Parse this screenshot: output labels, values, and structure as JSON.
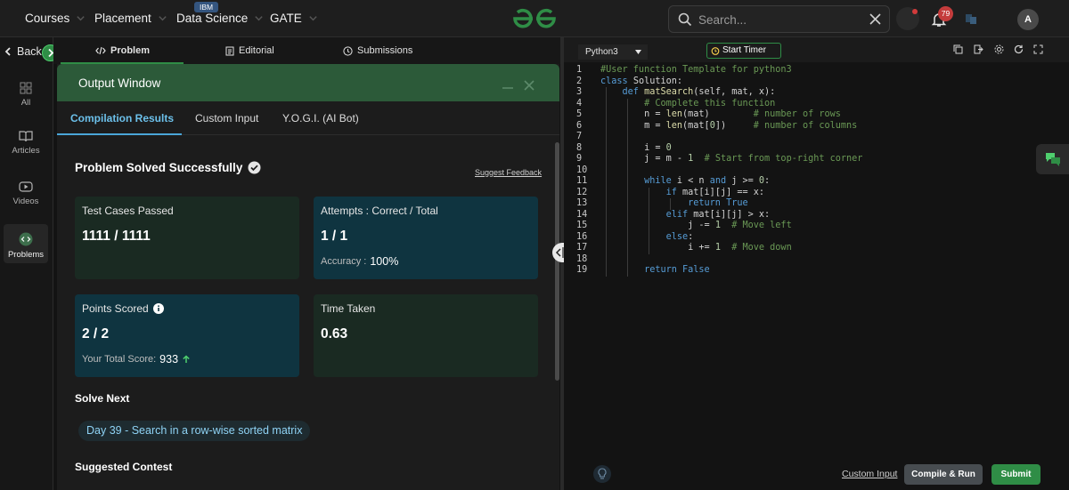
{
  "topnav": {
    "items": [
      {
        "label": "Courses"
      },
      {
        "label": "Placement"
      },
      {
        "label": "Data Science",
        "badge": "IBM"
      },
      {
        "label": "GATE"
      }
    ],
    "logo_icon": "geeksforgeeks-logo-icon",
    "search_placeholder": "Search...",
    "notification_count": "79",
    "avatar_initial": "A"
  },
  "sidebar": {
    "back_label": "Back",
    "items": [
      {
        "label": "All",
        "icon": "grid-icon"
      },
      {
        "label": "Articles",
        "icon": "book-icon"
      },
      {
        "label": "Videos",
        "icon": "video-icon"
      },
      {
        "label": "Problems",
        "icon": "code-icon",
        "active": true
      }
    ]
  },
  "problem_tabs": [
    {
      "label": "Problem",
      "active": true
    },
    {
      "label": "Editorial"
    },
    {
      "label": "Submissions"
    }
  ],
  "output": {
    "title": "Output Window",
    "tabs": [
      {
        "label": "Compilation Results",
        "active": true
      },
      {
        "label": "Custom Input"
      },
      {
        "label": "Y.O.G.I. (AI Bot)"
      }
    ],
    "status": "Problem Solved Successfully",
    "feedback_link": "Suggest Feedback",
    "cards": {
      "tests": {
        "label": "Test Cases Passed",
        "value": "1111 / 1111"
      },
      "attempts": {
        "label": "Attempts : Correct / Total",
        "value": "1 / 1",
        "sub_label": "Accuracy :",
        "sub_value": "100%"
      },
      "points": {
        "label": "Points Scored",
        "value": "2 / 2",
        "sub_label": "Your Total Score:",
        "sub_value": "933"
      },
      "time": {
        "label": "Time Taken",
        "value": "0.63"
      }
    },
    "solve_next_title": "Solve Next",
    "solve_next_item": "Day 39 - Search in a row-wise sorted matrix",
    "suggested_contest_title": "Suggested Contest"
  },
  "editor": {
    "language": "Python3",
    "timer_label": "Start Timer",
    "line_numbers": [
      "1",
      "2",
      "3",
      "4",
      "5",
      "6",
      "7",
      "8",
      "9",
      "10",
      "11",
      "12",
      "13",
      "14",
      "15",
      "16",
      "17",
      "18",
      "19"
    ],
    "code_lines": [
      [
        {
          "t": "#User function Template for python3",
          "c": "cm"
        }
      ],
      [
        {
          "t": "class ",
          "c": "kw"
        },
        {
          "t": "Solution:",
          "c": "pl"
        }
      ],
      [
        {
          "t": "    def ",
          "c": "kw"
        },
        {
          "t": "matSearch",
          "c": "df"
        },
        {
          "t": "(self, mat, x):",
          "c": "pl"
        }
      ],
      [
        {
          "t": "        # Complete this function",
          "c": "cm"
        }
      ],
      [
        {
          "t": "        n = ",
          "c": "pl"
        },
        {
          "t": "len",
          "c": "df"
        },
        {
          "t": "(mat)        ",
          "c": "pl"
        },
        {
          "t": "# number of rows",
          "c": "cm"
        }
      ],
      [
        {
          "t": "        m = ",
          "c": "pl"
        },
        {
          "t": "len",
          "c": "df"
        },
        {
          "t": "(mat[",
          "c": "pl"
        },
        {
          "t": "0",
          "c": "nm"
        },
        {
          "t": "])     ",
          "c": "pl"
        },
        {
          "t": "# number of columns",
          "c": "cm"
        }
      ],
      [
        {
          "t": "",
          "c": "pl"
        }
      ],
      [
        {
          "t": "        i = ",
          "c": "pl"
        },
        {
          "t": "0",
          "c": "nm"
        }
      ],
      [
        {
          "t": "        j = m - ",
          "c": "pl"
        },
        {
          "t": "1",
          "c": "nm"
        },
        {
          "t": "  ",
          "c": "pl"
        },
        {
          "t": "# Start from top-right corner",
          "c": "cm"
        }
      ],
      [
        {
          "t": "",
          "c": "pl"
        }
      ],
      [
        {
          "t": "        while ",
          "c": "kw"
        },
        {
          "t": "i < n ",
          "c": "pl"
        },
        {
          "t": "and ",
          "c": "kw"
        },
        {
          "t": "j >= ",
          "c": "pl"
        },
        {
          "t": "0",
          "c": "nm"
        },
        {
          "t": ":",
          "c": "pl"
        }
      ],
      [
        {
          "t": "            if ",
          "c": "kw"
        },
        {
          "t": "mat[i][j] == x:",
          "c": "pl"
        }
      ],
      [
        {
          "t": "                return ",
          "c": "kw"
        },
        {
          "t": "True",
          "c": "kw"
        }
      ],
      [
        {
          "t": "            elif ",
          "c": "kw"
        },
        {
          "t": "mat[i][j] > x:",
          "c": "pl"
        }
      ],
      [
        {
          "t": "                j -= ",
          "c": "pl"
        },
        {
          "t": "1",
          "c": "nm"
        },
        {
          "t": "  ",
          "c": "pl"
        },
        {
          "t": "# Move left",
          "c": "cm"
        }
      ],
      [
        {
          "t": "            else",
          "c": "kw"
        },
        {
          "t": ":",
          "c": "pl"
        }
      ],
      [
        {
          "t": "                i += ",
          "c": "pl"
        },
        {
          "t": "1",
          "c": "nm"
        },
        {
          "t": "  ",
          "c": "pl"
        },
        {
          "t": "# Move down",
          "c": "cm"
        }
      ],
      [
        {
          "t": "",
          "c": "pl"
        }
      ],
      [
        {
          "t": "        return ",
          "c": "kw"
        },
        {
          "t": "False",
          "c": "kw"
        }
      ]
    ],
    "custom_input_label": "Custom Input",
    "compile_label": "Compile & Run",
    "submit_label": "Submit"
  },
  "colors": {
    "brand_green": "#2f8d46",
    "output_header": "#2c5a39",
    "card_green": "#1a2a22",
    "card_teal": "#0f3440",
    "accent_blue": "#6cc0ea"
  }
}
